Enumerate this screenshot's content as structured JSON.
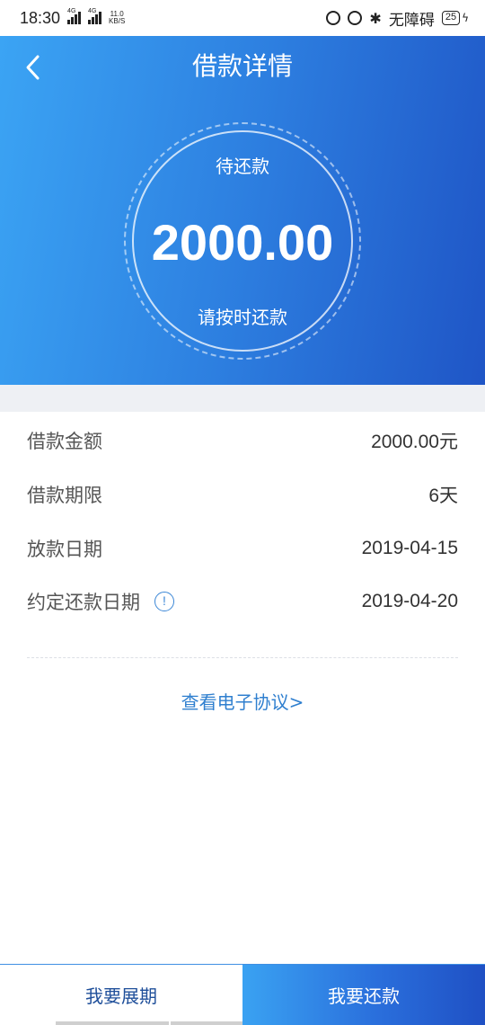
{
  "status_bar": {
    "time": "18:30",
    "network1": "4G",
    "network2": "4G",
    "speed_value": "11.0",
    "speed_unit": "KB/S",
    "accessibility": "无障碍",
    "battery": "25"
  },
  "header": {
    "title": "借款详情",
    "back_icon": "chevron-left-icon",
    "amount_label": "待还款",
    "amount": "2000.00",
    "amount_note": "请按时还款"
  },
  "details": [
    {
      "label": "借款金额",
      "value": "2000.00元"
    },
    {
      "label": "借款期限",
      "value": "6天"
    },
    {
      "label": "放款日期",
      "value": "2019-04-15"
    },
    {
      "label": "约定还款日期",
      "value": "2019-04-20",
      "icon": "info-icon"
    }
  ],
  "agreement_link": "查看电子协议>",
  "bottom": {
    "extend_label": "我要展期",
    "repay_label": "我要还款"
  },
  "colors": {
    "accent": "#2d7fe0",
    "link": "#2f7fcf",
    "dark_blue": "#1f4f9a"
  }
}
